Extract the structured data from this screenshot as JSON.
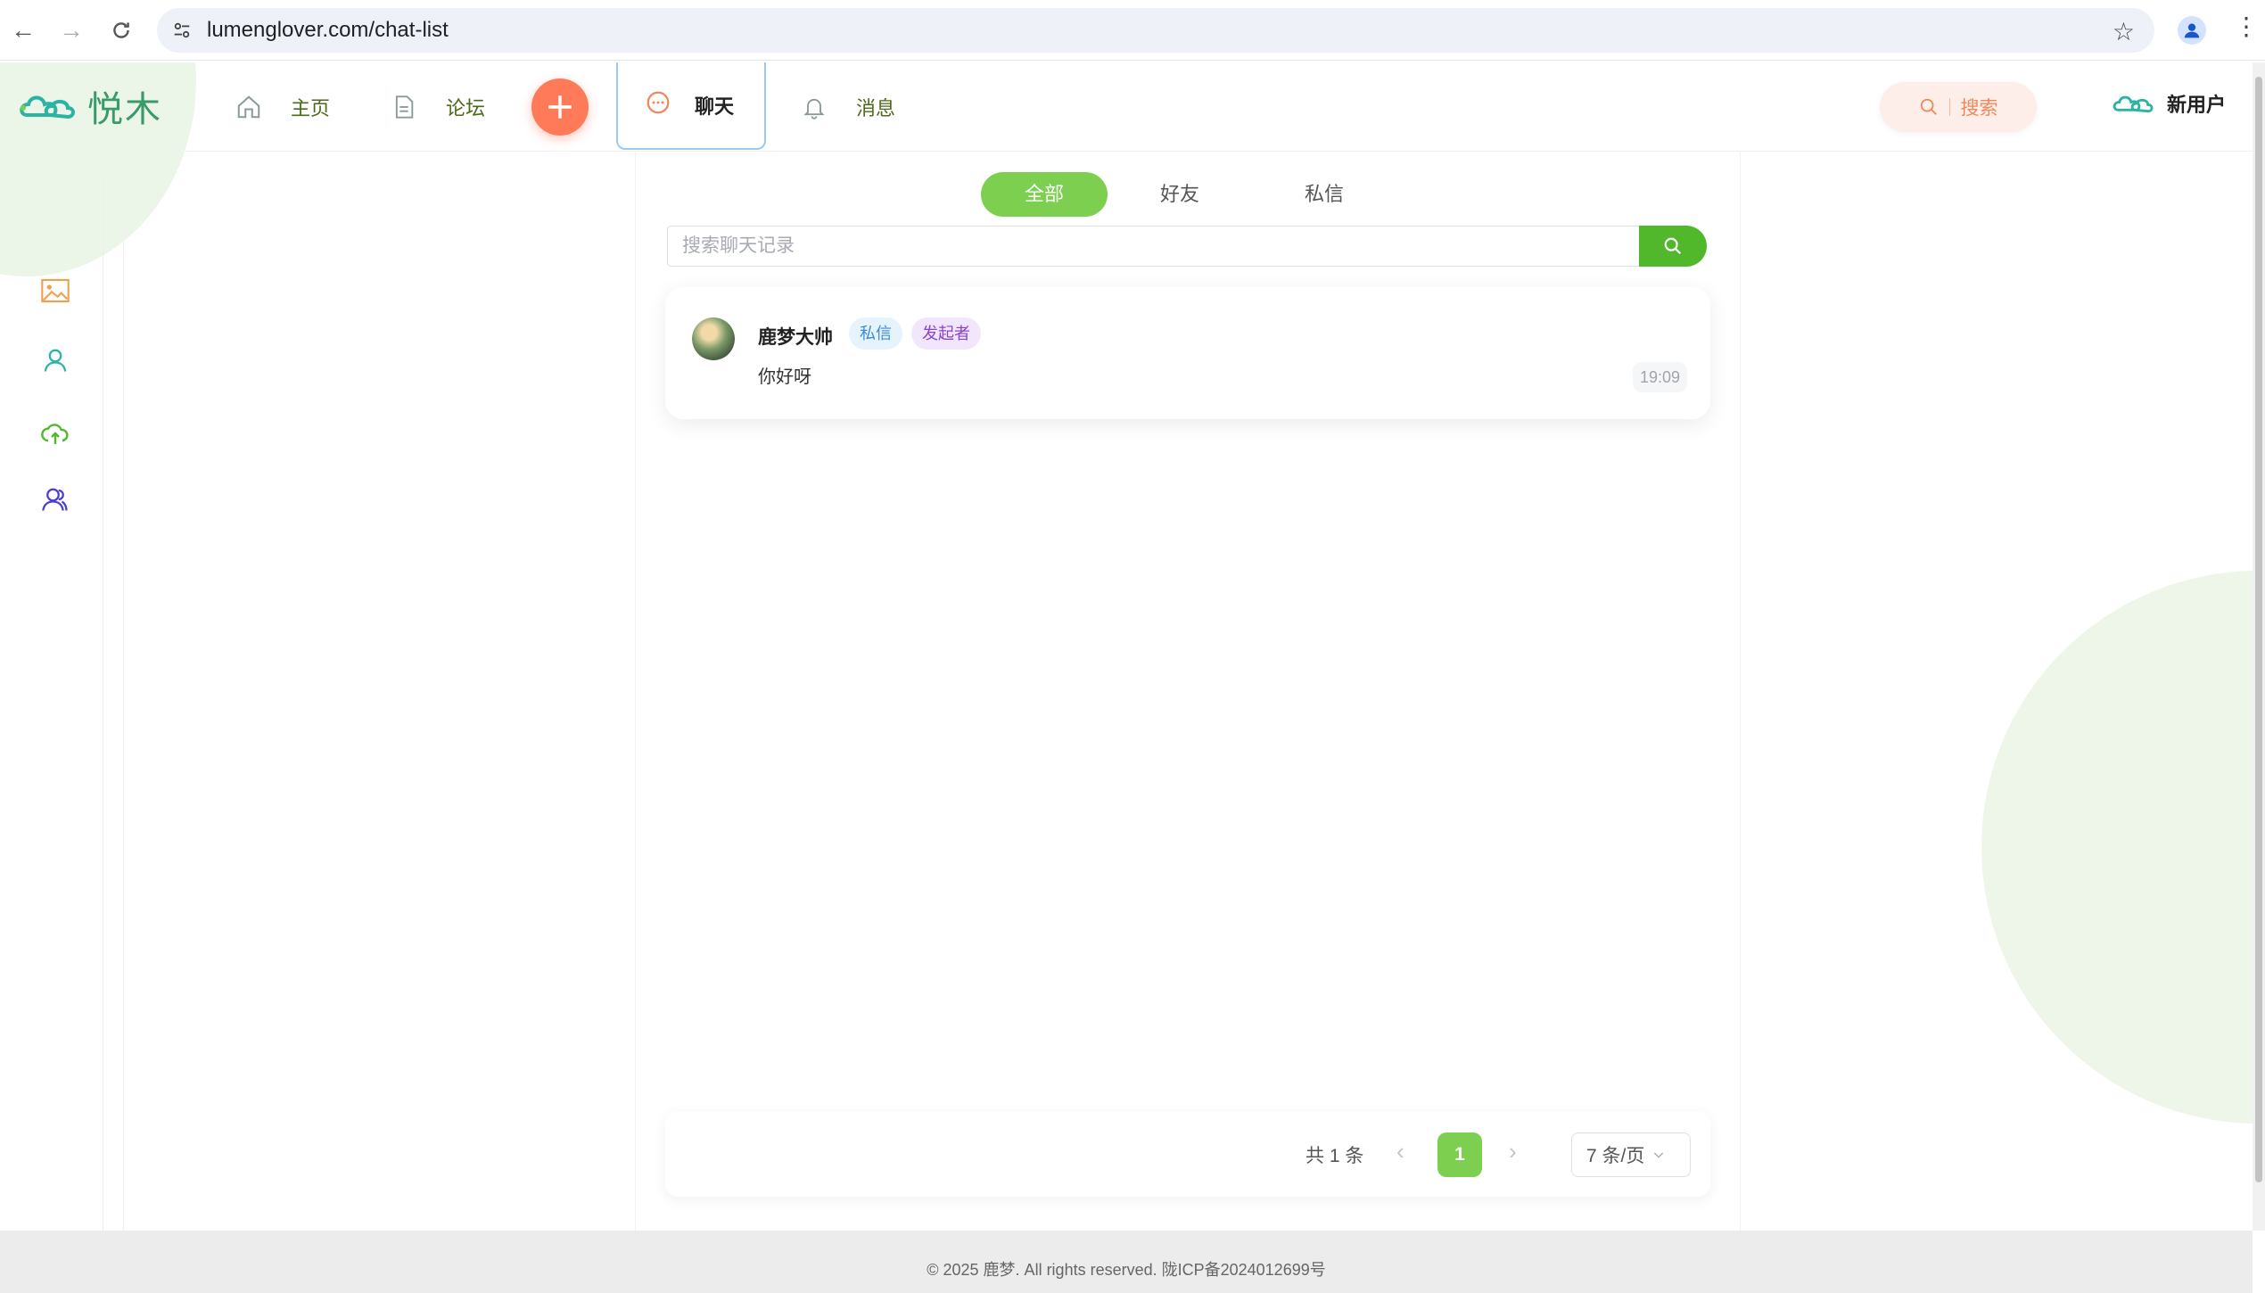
{
  "browser": {
    "url": "lumenglover.com/chat-list"
  },
  "header": {
    "logo_text": "悦木",
    "nav": {
      "home": "主页",
      "forum": "论坛",
      "chat": "聊天",
      "messages": "消息"
    },
    "search_label": "搜索",
    "user_name": "新用户"
  },
  "filters": {
    "all": "全部",
    "friends": "好友",
    "private": "私信"
  },
  "search": {
    "placeholder": "搜索聊天记录"
  },
  "chats": [
    {
      "name": "鹿梦大帅",
      "tags": [
        "私信",
        "发起者"
      ],
      "message": "你好呀",
      "time": "19:09"
    }
  ],
  "pagination": {
    "total": "共 1 条",
    "current_page": "1",
    "page_size": "7 条/页"
  },
  "footer": {
    "text": "© 2025 鹿梦. All rights reserved. 陇ICP备2024012699号"
  },
  "colors": {
    "accent_green": "#7ccf4f",
    "search_button": "#52b82b",
    "plus_button": "#ff7a59"
  }
}
